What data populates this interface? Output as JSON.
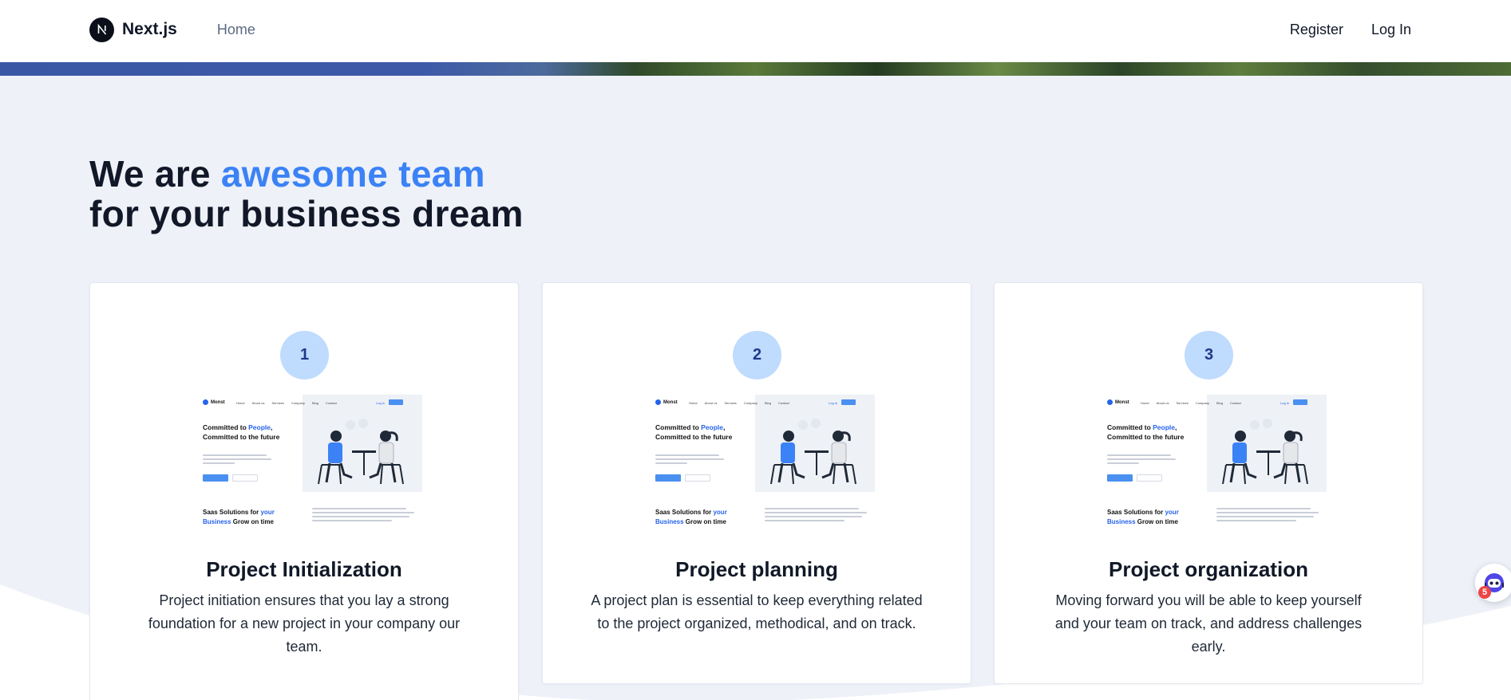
{
  "nav": {
    "brand": "Next.js",
    "brand_logo_letter": "N",
    "home": "Home",
    "register": "Register",
    "login": "Log In"
  },
  "heading": {
    "line1_prefix": "We are ",
    "line1_accent": "awesome team",
    "line2": "for your business dream"
  },
  "preview": {
    "logo_text": "Monst",
    "nav_links": [
      "Home",
      "About us",
      "Services",
      "Company",
      "Blog",
      "Contact"
    ],
    "login": "Log In",
    "headline_prefix": "Committed to ",
    "headline_accent": "People",
    "headline_suffix": ", Committed to the future",
    "sub_prefix": "Saas Solutions for ",
    "sub_accent": "your Business",
    "sub_suffix": " Grow on time"
  },
  "cards": [
    {
      "number": "1",
      "title": "Project Initialization",
      "description": "Project initiation ensures that you lay a strong foundation for a new project in your company our team."
    },
    {
      "number": "2",
      "title": "Project planning",
      "description": "A project plan is essential to keep everything related to the project organized, methodical, and on track."
    },
    {
      "number": "3",
      "title": "Project organization",
      "description": "Moving forward you will be able to keep yourself and your team on track, and address challenges early."
    }
  ],
  "floating_widget": {
    "icon": "chat-bot-icon",
    "badge_count": "5"
  },
  "colors": {
    "accent": "#3b82f6",
    "page_background": "#eef1f8",
    "step_circle": "#bfdbfe",
    "badge": "#ef4444"
  }
}
